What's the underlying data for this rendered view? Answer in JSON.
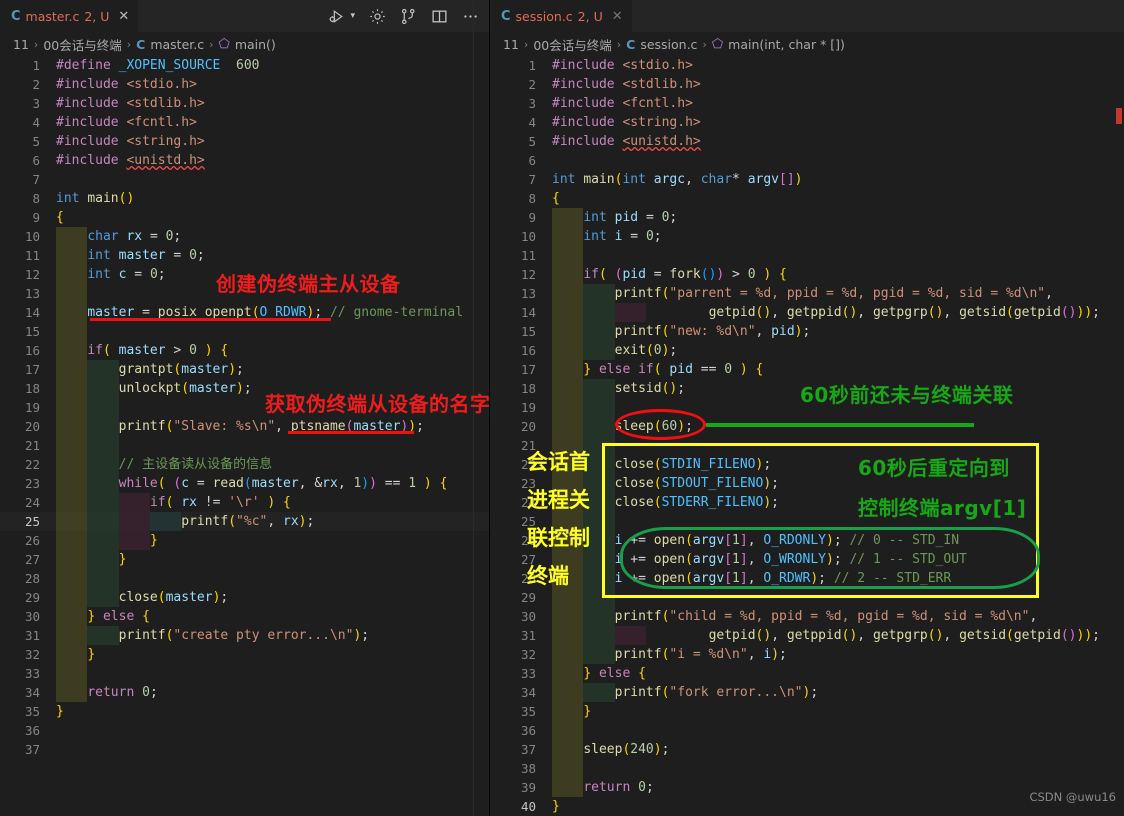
{
  "editors": [
    {
      "tab": {
        "lang_icon": "c-file-icon",
        "name": "master.c",
        "badge": "2, U",
        "close": "✕"
      },
      "breadcrumb": {
        "root": "11",
        "folder": "00会话与终端",
        "lang_icon": "c-file-icon",
        "file": "master.c",
        "symbol_icon": "symbol-method-icon",
        "symbol": "main()",
        "sep": "›"
      },
      "lines": [
        {
          "n": "1",
          "text": "#define _XOPEN_SOURCE  600"
        },
        {
          "n": "2",
          "text": "#include <stdio.h>"
        },
        {
          "n": "3",
          "text": "#include <stdlib.h>"
        },
        {
          "n": "4",
          "text": "#include <fcntl.h>"
        },
        {
          "n": "5",
          "text": "#include <string.h>"
        },
        {
          "n": "6",
          "text": "#include <unistd.h>"
        },
        {
          "n": "7",
          "text": ""
        },
        {
          "n": "8",
          "text": "int main()"
        },
        {
          "n": "9",
          "text": "{"
        },
        {
          "n": "10",
          "text": "    char rx = 0;"
        },
        {
          "n": "11",
          "text": "    int master = 0;"
        },
        {
          "n": "12",
          "text": "    int c = 0;"
        },
        {
          "n": "13",
          "text": ""
        },
        {
          "n": "14",
          "text": "    master = posix_openpt(O_RDWR); // gnome-terminal"
        },
        {
          "n": "15",
          "text": ""
        },
        {
          "n": "16",
          "text": "    if( master > 0 ) {"
        },
        {
          "n": "17",
          "text": "        grantpt(master);"
        },
        {
          "n": "18",
          "text": "        unlockpt(master);"
        },
        {
          "n": "19",
          "text": ""
        },
        {
          "n": "20",
          "text": "        printf(\"Slave: %s\\n\", ptsname(master));"
        },
        {
          "n": "21",
          "text": ""
        },
        {
          "n": "22",
          "text": "        // 主设备读从设备的信息"
        },
        {
          "n": "23",
          "text": "        while( (c = read(master, &rx, 1)) == 1 ) {"
        },
        {
          "n": "24",
          "text": "            if( rx != '\\r' ) {"
        },
        {
          "n": "25",
          "text": "                printf(\"%c\", rx);"
        },
        {
          "n": "26",
          "text": "            }"
        },
        {
          "n": "27",
          "text": "        }"
        },
        {
          "n": "28",
          "text": ""
        },
        {
          "n": "29",
          "text": "        close(master);"
        },
        {
          "n": "30",
          "text": "    } else {"
        },
        {
          "n": "31",
          "text": "        printf(\"create pty error...\\n\");"
        },
        {
          "n": "32",
          "text": "    }"
        },
        {
          "n": "33",
          "text": ""
        },
        {
          "n": "34",
          "text": "    return 0;"
        },
        {
          "n": "35",
          "text": "}"
        },
        {
          "n": "36",
          "text": ""
        },
        {
          "n": "37",
          "text": ""
        }
      ],
      "annotations": [
        {
          "kind": "red-text",
          "text": "创建伪终端主从设备"
        },
        {
          "kind": "red-text",
          "text": "获取伪终端从设备的名字"
        }
      ]
    },
    {
      "tab": {
        "lang_icon": "c-file-icon",
        "name": "session.c",
        "badge": "2, U",
        "close": "✕"
      },
      "breadcrumb": {
        "root": "11",
        "folder": "00会话与终端",
        "lang_icon": "c-file-icon",
        "file": "session.c",
        "symbol_icon": "symbol-method-icon",
        "symbol": "main(int, char * [])",
        "sep": "›"
      },
      "lines": [
        {
          "n": "1",
          "text": "#include <stdio.h>"
        },
        {
          "n": "2",
          "text": "#include <stdlib.h>"
        },
        {
          "n": "3",
          "text": "#include <fcntl.h>"
        },
        {
          "n": "4",
          "text": "#include <string.h>"
        },
        {
          "n": "5",
          "text": "#include <unistd.h>"
        },
        {
          "n": "6",
          "text": ""
        },
        {
          "n": "7",
          "text": "int main(int argc, char* argv[])"
        },
        {
          "n": "8",
          "text": "{"
        },
        {
          "n": "9",
          "text": "    int pid = 0;"
        },
        {
          "n": "10",
          "text": "    int i = 0;"
        },
        {
          "n": "11",
          "text": ""
        },
        {
          "n": "12",
          "text": "    if( (pid = fork()) > 0 ) {"
        },
        {
          "n": "13",
          "text": "        printf(\"parrent = %d, ppid = %d, pgid = %d, sid = %d\\n\","
        },
        {
          "n": "14",
          "text": "                    getpid(), getppid(), getpgrp(), getsid(getpid()));"
        },
        {
          "n": "15",
          "text": "        printf(\"new: %d\\n\", pid);"
        },
        {
          "n": "16",
          "text": "        exit(0);"
        },
        {
          "n": "17",
          "text": "    } else if( pid == 0 ) {"
        },
        {
          "n": "18",
          "text": "        setsid();"
        },
        {
          "n": "19",
          "text": ""
        },
        {
          "n": "20",
          "text": "        sleep(60);"
        },
        {
          "n": "21",
          "text": ""
        },
        {
          "n": "22",
          "text": "        close(STDIN_FILENO);"
        },
        {
          "n": "23",
          "text": "        close(STDOUT_FILENO);"
        },
        {
          "n": "24",
          "text": "        close(STDERR_FILENO);"
        },
        {
          "n": "25",
          "text": ""
        },
        {
          "n": "26",
          "text": "        i += open(argv[1], O_RDONLY); // 0 -- STD_IN"
        },
        {
          "n": "27",
          "text": "        i += open(argv[1], O_WRONLY); // 1 -- STD_OUT"
        },
        {
          "n": "28",
          "text": "        i += open(argv[1], O_RDWR); // 2 -- STD_ERR"
        },
        {
          "n": "29",
          "text": ""
        },
        {
          "n": "30",
          "text": "        printf(\"child = %d, ppid = %d, pgid = %d, sid = %d\\n\","
        },
        {
          "n": "31",
          "text": "                    getpid(), getppid(), getpgrp(), getsid(getpid()));"
        },
        {
          "n": "32",
          "text": "        printf(\"i = %d\\n\", i);"
        },
        {
          "n": "33",
          "text": "    } else {"
        },
        {
          "n": "34",
          "text": "        printf(\"fork error...\\n\");"
        },
        {
          "n": "35",
          "text": "    }"
        },
        {
          "n": "36",
          "text": ""
        },
        {
          "n": "37",
          "text": "    sleep(240);"
        },
        {
          "n": "38",
          "text": ""
        },
        {
          "n": "39",
          "text": "    return 0;"
        },
        {
          "n": "40",
          "text": "}"
        }
      ],
      "annotations": [
        {
          "kind": "green-text",
          "text": "60秒前还未与终端关联"
        },
        {
          "kind": "green-text",
          "text": "60秒后重定向到"
        },
        {
          "kind": "green-text",
          "text": "控制终端argv[1]"
        },
        {
          "kind": "yellow-text",
          "text": "会话首"
        },
        {
          "kind": "yellow-text",
          "text": "进程关"
        },
        {
          "kind": "yellow-text",
          "text": "联控制"
        },
        {
          "kind": "yellow-text",
          "text": "终端"
        }
      ]
    }
  ],
  "toolbar": {
    "run_label": "run-and-debug-icon",
    "run_chevron": "chevron-down-icon",
    "settings_label": "gear-icon",
    "source_control_label": "source-control-icon",
    "split_label": "split-editor-icon",
    "more_label": "more-actions-icon"
  },
  "watermark": "CSDN @uwu16",
  "colors": {
    "editor_bg": "#1e1e1e",
    "tabbar_bg": "#252526",
    "anno_red": "#ef1c1c",
    "anno_green": "#16a816",
    "anno_yellow": "#ffff22",
    "error_marker": "#f14c4c"
  }
}
